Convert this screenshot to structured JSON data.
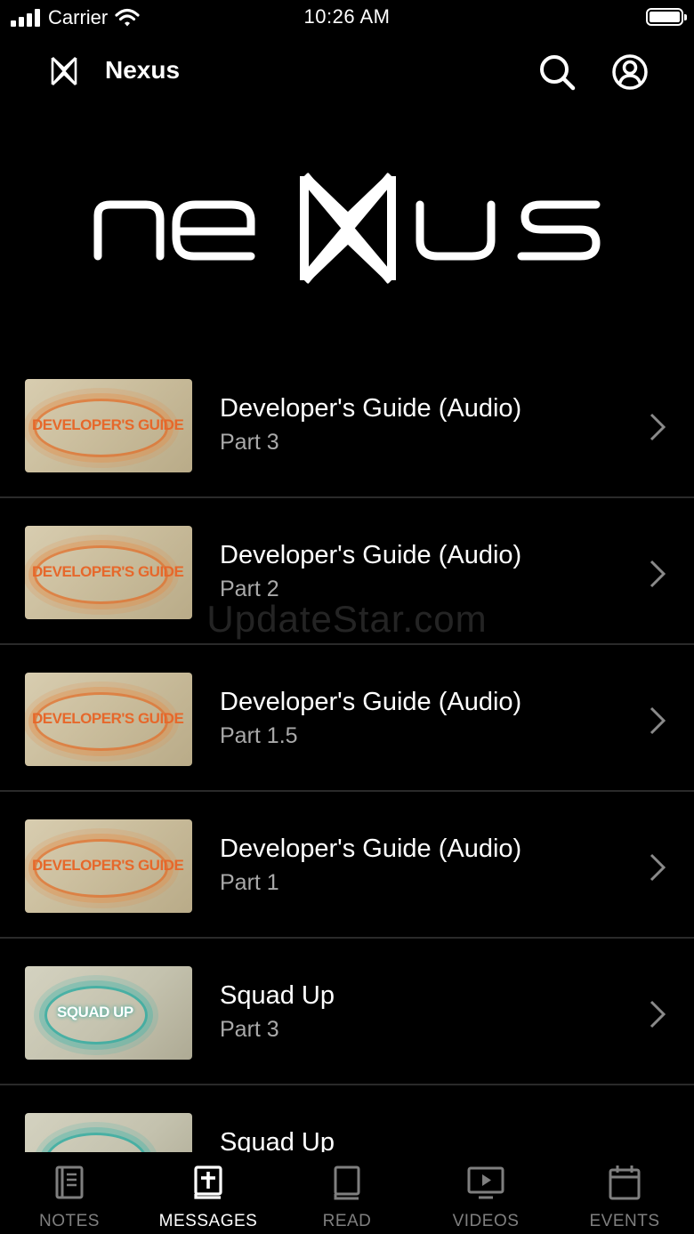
{
  "status_bar": {
    "carrier": "Carrier",
    "time": "10:26 AM",
    "signal_icon": "signal-icon",
    "wifi_icon": "wifi-icon",
    "battery_icon": "battery-icon"
  },
  "header": {
    "app_title": "Nexus",
    "logo_icon": "nexus-logo-icon",
    "search_icon": "search-icon",
    "account_icon": "account-icon"
  },
  "hero": {
    "wordmark": "nexus"
  },
  "messages": [
    {
      "title": "Developer's Guide (Audio)",
      "subtitle": "Part 3",
      "thumb_text": "DEVELOPER'S GUIDE",
      "thumb_style": "dev"
    },
    {
      "title": "Developer's Guide (Audio)",
      "subtitle": "Part 2",
      "thumb_text": "DEVELOPER'S GUIDE",
      "thumb_style": "dev"
    },
    {
      "title": "Developer's Guide (Audio)",
      "subtitle": "Part 1.5",
      "thumb_text": "DEVELOPER'S GUIDE",
      "thumb_style": "dev"
    },
    {
      "title": "Developer's Guide (Audio)",
      "subtitle": "Part 1",
      "thumb_text": "DEVELOPER'S GUIDE",
      "thumb_style": "dev"
    },
    {
      "title": "Squad Up",
      "subtitle": "Part 3",
      "thumb_text": "SQUAD UP",
      "thumb_style": "squad"
    },
    {
      "title": "Squad Up",
      "subtitle": "",
      "thumb_text": "",
      "thumb_style": "squad"
    }
  ],
  "watermark": "UpdateStar.com",
  "tabs": [
    {
      "label": "NOTES",
      "icon": "notes-icon",
      "active": false
    },
    {
      "label": "MESSAGES",
      "icon": "messages-icon",
      "active": true
    },
    {
      "label": "READ",
      "icon": "book-icon",
      "active": false
    },
    {
      "label": "VIDEOS",
      "icon": "video-icon",
      "active": false
    },
    {
      "label": "EVENTS",
      "icon": "calendar-icon",
      "active": false
    }
  ],
  "colors": {
    "background": "#000000",
    "text_primary": "#ffffff",
    "text_secondary": "#a9a9a9",
    "tab_inactive": "#7f7f7f",
    "divider": "#2a2a2a",
    "thumb_accent_dev": "#e6682b",
    "thumb_accent_squad": "#1aa59a"
  }
}
